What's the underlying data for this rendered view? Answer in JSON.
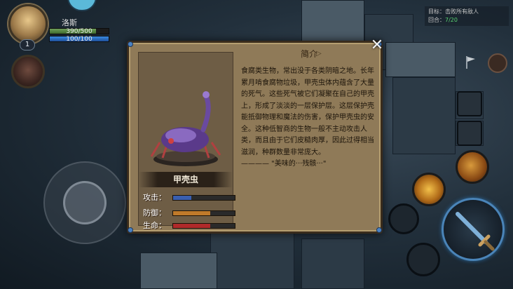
{
  "player": {
    "name": "洛斯",
    "level": "1",
    "hp_text": "390/500",
    "hp_fraction": 0.78,
    "mp_text": "100/100",
    "mp_fraction": 1.0
  },
  "objective": {
    "target_label": "目标：",
    "target_value": "击败所有敌人",
    "round_label": "回合：",
    "round_value": "7/20"
  },
  "panel": {
    "intro_title": "简介",
    "monster_name": "甲壳虫",
    "description": "食腐类生物，常出没于各类阴暗之地。长年累月啃食腐物垃圾，甲壳虫体内蕴含了大量的死气。这些死气被它们凝聚在自己的甲壳上，形成了淡淡的一层保护层。这层保护壳能抵御物理和魔法的伤害，保护甲壳虫的安全。这种低智商的生物一般不主动攻击人类，而且由于它们皮糙肉厚，因此过得相当滋润，种群数量非常庞大。\n———— \"美味的···残骸···\"",
    "stats": [
      {
        "label": "攻击：",
        "fraction": 0.3,
        "color": "#3a5fb0"
      },
      {
        "label": "防御：",
        "fraction": 0.6,
        "color": "#c07a2a"
      },
      {
        "label": "生命：",
        "fraction": 0.6,
        "color": "#b02a2a"
      }
    ],
    "close_symbol": "✕"
  },
  "icons": {
    "close": "close-icon",
    "flag": "flag-icon",
    "menu": "menu-icon"
  },
  "colors": {
    "panel_bg": "#8f7a58",
    "hp": "#4e8a3a",
    "mp": "#2a6ac0"
  }
}
